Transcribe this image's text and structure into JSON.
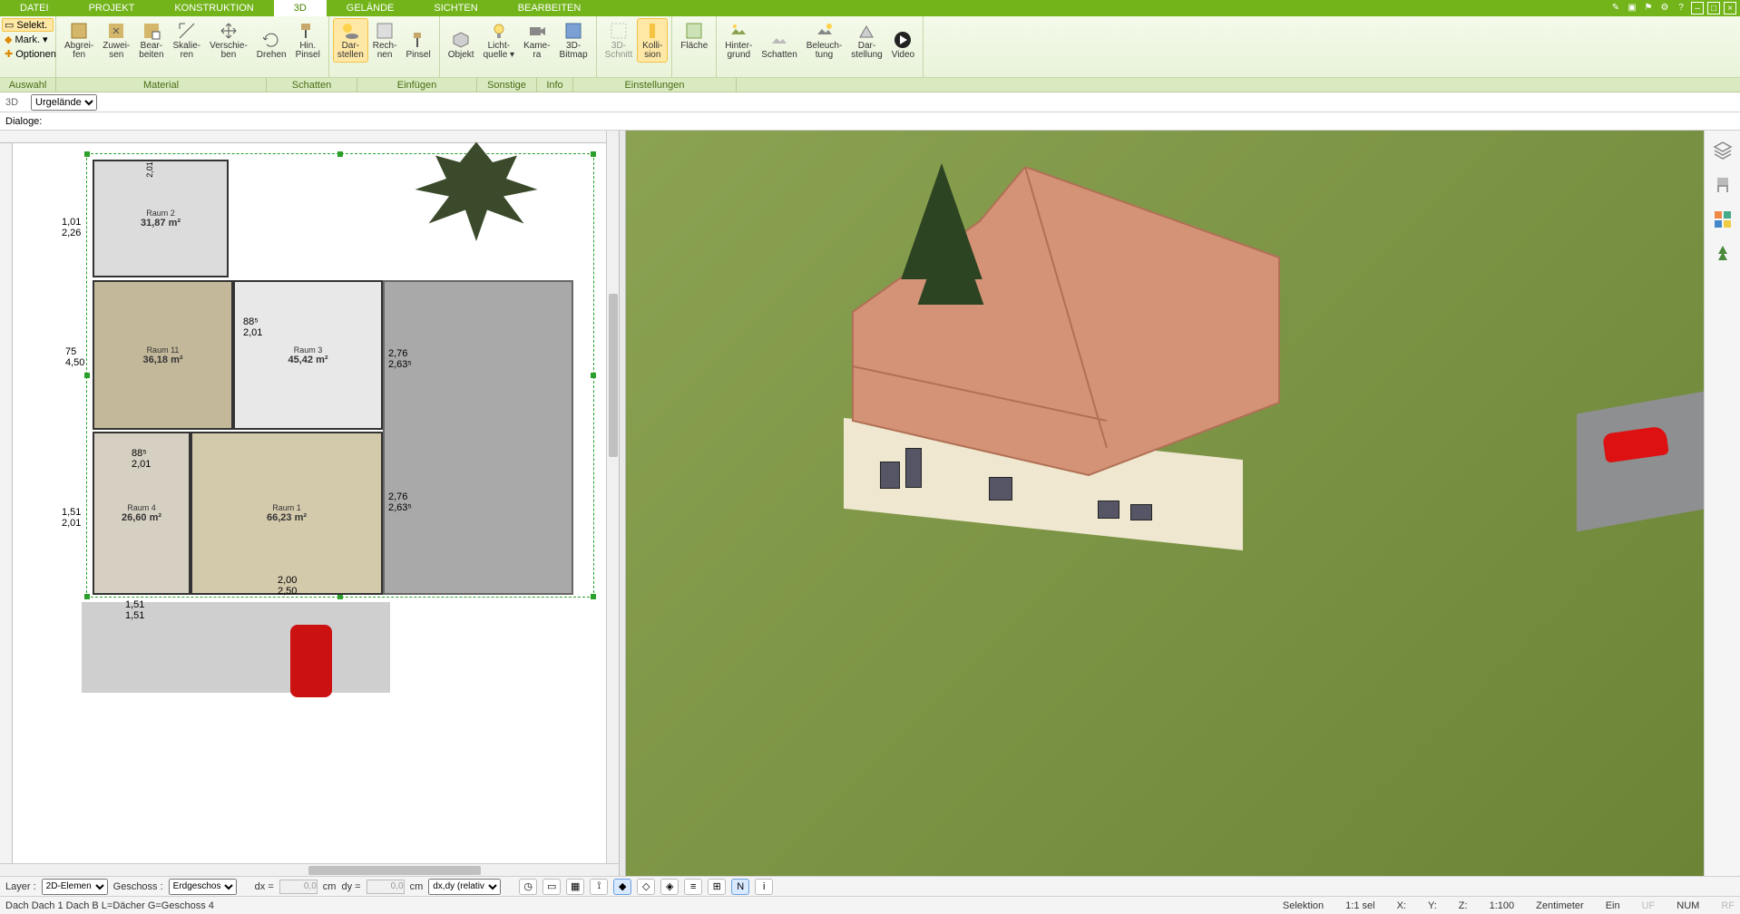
{
  "menu": {
    "tabs": [
      "DATEI",
      "PROJEKT",
      "KONSTRUKTION",
      "3D",
      "GELÄNDE",
      "SICHTEN",
      "BEARBEITEN"
    ],
    "active": 3
  },
  "leftsel": {
    "selekt": "Selekt.",
    "mark": "Mark.",
    "optionen": "Optionen"
  },
  "ribbon_groups": {
    "auswahl": "Auswahl",
    "material": "Material",
    "schatten": "Schatten",
    "einfuegen": "Einfügen",
    "sonstige": "Sonstige",
    "info": "Info",
    "einstellungen": "Einstellungen"
  },
  "ribbon": {
    "abgreifen": "Abgrei-\nfen",
    "zuweisen": "Zuwei-\nsen",
    "bearbeiten": "Bear-\nbeiten",
    "skalieren": "Skalie-\nren",
    "verschieben": "Verschie-\nben",
    "drehen": "Drehen",
    "hinpinsel": "Hin.\nPinsel",
    "darstellen": "Dar-\nstellen",
    "rechnen": "Rech-\nnen",
    "pinsel": "Pinsel",
    "objekt": "Objekt",
    "lichtquelle": "Licht-\nquelle ▾",
    "kamera": "Kame-\nra",
    "bitmap": "3D-\nBitmap",
    "schnitt": "3D-\nSchnitt",
    "kollision": "Kolli-\nsion",
    "flaeche": "Fläche",
    "hintergrund": "Hinter-\ngrund",
    "schatten": "Schatten",
    "beleuchtung": "Beleuch-\ntung",
    "darstellung": "Dar-\nstellung",
    "video": "Video"
  },
  "strip": {
    "mode": "3D",
    "urgelaende": "Urgelände",
    "dialoge": "Dialoge:"
  },
  "rooms": {
    "r2": {
      "name": "Raum 2",
      "area": "31,87 m²"
    },
    "r11": {
      "name": "Raum 11",
      "area": "36,18 m²"
    },
    "r3": {
      "name": "Raum 3",
      "area": "45,42 m²"
    },
    "r4": {
      "name": "Raum 4",
      "area": "26,60 m²"
    },
    "r1": {
      "name": "Raum 1",
      "area": "66,23 m²"
    }
  },
  "dims": {
    "d1_top": "1,01",
    "d1_bot": "2,26",
    "d2": "2,01",
    "d3": "88⁵",
    "d4": "2,01",
    "d5": "75",
    "d6": "4,50",
    "d7": "2,76",
    "d8": "2,63⁵",
    "d9": "2,76",
    "d10": "2,63⁵",
    "d11_top": "1,51",
    "d11_bot": "2,01",
    "d12_top": "1,51",
    "d12_bot": "1,51",
    "d13": "2,00",
    "d14": "2,50",
    "d15": "88⁵",
    "d16": "2,01"
  },
  "bottom": {
    "layer_lbl": "Layer :",
    "layer_val": "2D-Elemen",
    "geschoss_lbl": "Geschoss :",
    "geschoss_val": "Erdgeschos",
    "dx_lbl": "dx =",
    "dx_val": "0,0",
    "dy_lbl": "dy =",
    "dy_val": "0,0",
    "cm": "cm",
    "mode": "dx,dy (relativ ka"
  },
  "status": {
    "left": "Dach Dach 1 Dach B L=Dächer G=Geschoss 4",
    "selektion": "Selektion",
    "sel_count": "1:1 sel",
    "x": "X:",
    "y": "Y:",
    "z": "Z:",
    "scale": "1:100",
    "unit": "Zentimeter",
    "ein": "Ein",
    "uf": "UF",
    "num": "NUM",
    "rf": "RF"
  }
}
